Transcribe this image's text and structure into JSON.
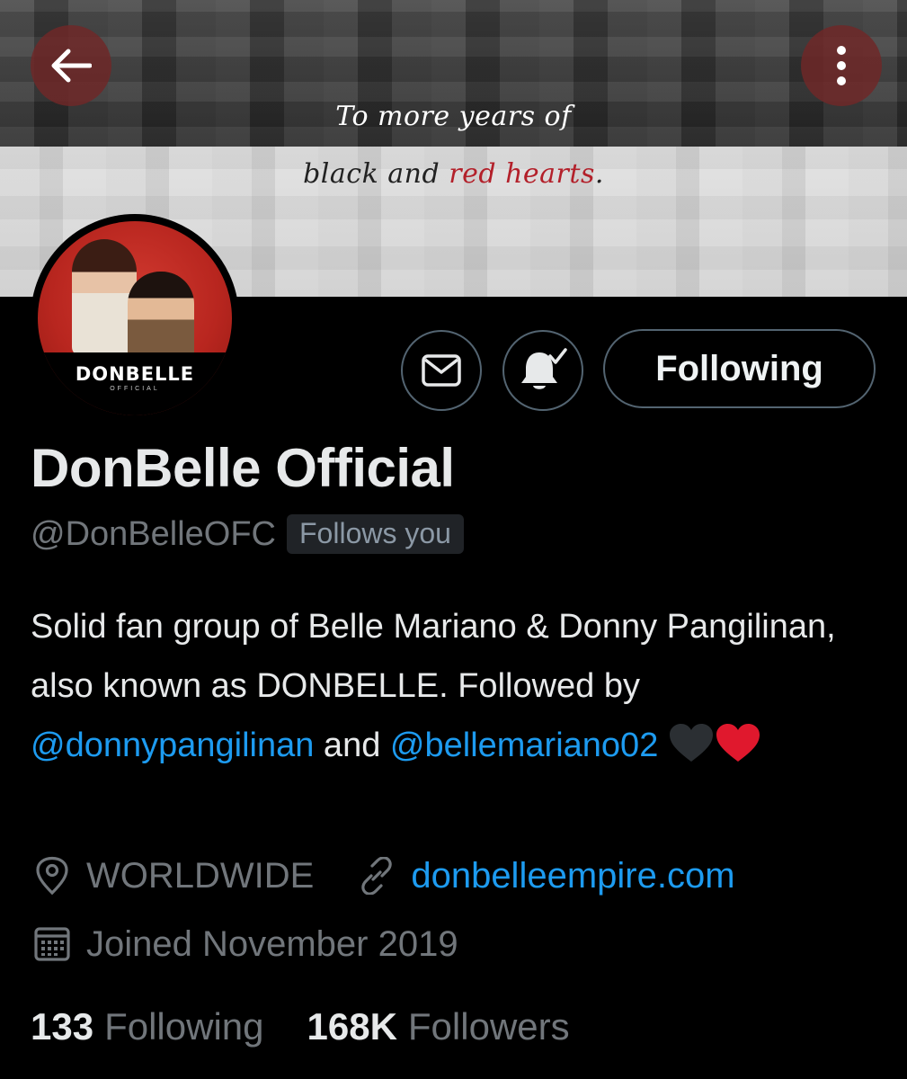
{
  "banner": {
    "line1": "To more years of",
    "line2_start": "black and ",
    "line2_red": "red hearts",
    "line2_end": "."
  },
  "navigation": {
    "back_icon": "arrow-left-icon",
    "more_icon": "vertical-ellipsis-icon"
  },
  "avatar": {
    "name": "DONBELLE",
    "sub": "OFFICIAL"
  },
  "actions": {
    "message_icon": "envelope-icon",
    "notify_icon": "bell-check-icon",
    "following_label": "Following"
  },
  "profile": {
    "display_name": "DonBelle Official",
    "handle": "@DonBelleOFC",
    "follows_you": "Follows you",
    "bio": {
      "text1": "Solid fan group of Belle Mariano & Donny Pangilinan, also known as DONBELLE. Followed by ",
      "mention1": "@donnypangilinan",
      "text2": " and ",
      "mention2": "@bellemariano02",
      "emoji": [
        "black-heart",
        "red-heart"
      ]
    },
    "location": "WORLDWIDE",
    "website": "donbelleempire.com",
    "joined": "Joined November 2019"
  },
  "stats": {
    "following_count": "133",
    "following_label": "Following",
    "followers_count": "168K",
    "followers_label": "Followers"
  },
  "colors": {
    "background": "#000000",
    "accent_link": "#1d9bf0",
    "secondary_text": "#71767b",
    "primary_text": "#e7e9ea",
    "banner_button": "#6e2828",
    "red_heart": "#e0182d",
    "black_heart": "#2b2f33"
  }
}
